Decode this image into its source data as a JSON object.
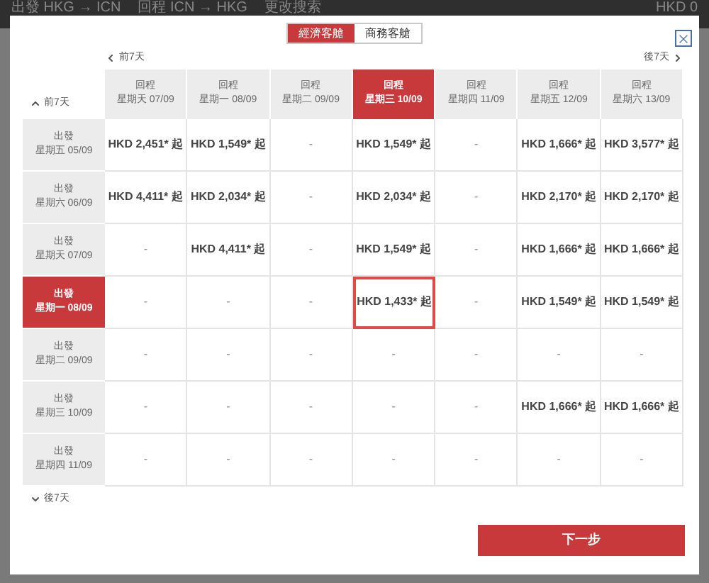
{
  "top_bar": {
    "outbound": "出發 HKG → ICN",
    "return": "回程 ICN → HKG",
    "change_search": "更改搜索",
    "total": "HKD 0"
  },
  "cabin_tabs": [
    {
      "label": "經濟客艙",
      "selected": true
    },
    {
      "label": "商務客艙",
      "selected": false
    }
  ],
  "nav": {
    "prev_week": "前7天",
    "next_week": "後7天"
  },
  "grid": {
    "prev_rows": "前7天",
    "next_rows": "後7天",
    "columns": [
      {
        "label": "回程",
        "date": "星期天 07/09",
        "selected": false
      },
      {
        "label": "回程",
        "date": "星期一 08/09",
        "selected": false
      },
      {
        "label": "回程",
        "date": "星期二 09/09",
        "selected": false
      },
      {
        "label": "回程",
        "date": "星期三 10/09",
        "selected": true
      },
      {
        "label": "回程",
        "date": "星期四 11/09",
        "selected": false
      },
      {
        "label": "回程",
        "date": "星期五 12/09",
        "selected": false
      },
      {
        "label": "回程",
        "date": "星期六 13/09",
        "selected": false
      }
    ],
    "rows": [
      {
        "label": "出發",
        "date": "星期五 05/09",
        "selected": false,
        "cells": [
          "HKD 2,451* 起",
          "HKD 1,549* 起",
          "-",
          "HKD 1,549* 起",
          "-",
          "HKD 1,666* 起",
          "HKD 3,577* 起"
        ]
      },
      {
        "label": "出發",
        "date": "星期六 06/09",
        "selected": false,
        "cells": [
          "HKD 4,411* 起",
          "HKD 2,034* 起",
          "-",
          "HKD 2,034* 起",
          "-",
          "HKD 2,170* 起",
          "HKD 2,170* 起"
        ]
      },
      {
        "label": "出發",
        "date": "星期天 07/09",
        "selected": false,
        "cells": [
          "-",
          "HKD 4,411* 起",
          "-",
          "HKD 1,549* 起",
          "-",
          "HKD 1,666* 起",
          "HKD 1,666* 起"
        ]
      },
      {
        "label": "出發",
        "date": "星期一 08/09",
        "selected": true,
        "cells": [
          "-",
          "-",
          "-",
          "HKD 1,433* 起",
          "-",
          "HKD 1,549* 起",
          "HKD 1,549* 起"
        ]
      },
      {
        "label": "出發",
        "date": "星期二 09/09",
        "selected": false,
        "cells": [
          "-",
          "-",
          "-",
          "-",
          "-",
          "-",
          "-"
        ]
      },
      {
        "label": "出發",
        "date": "星期三 10/09",
        "selected": false,
        "cells": [
          "-",
          "-",
          "-",
          "-",
          "-",
          "HKD 1,666* 起",
          "HKD 1,666* 起"
        ]
      },
      {
        "label": "出發",
        "date": "星期四 11/09",
        "selected": false,
        "cells": [
          "-",
          "-",
          "-",
          "-",
          "-",
          "-",
          "-"
        ]
      }
    ]
  },
  "next_button": "下一步"
}
